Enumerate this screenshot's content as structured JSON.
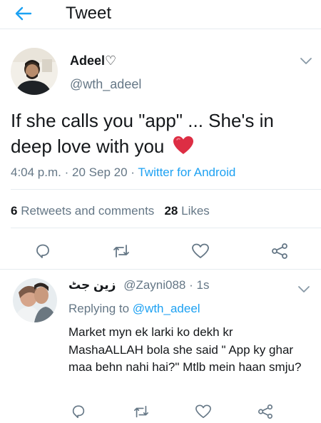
{
  "header": {
    "title": "Tweet",
    "back_icon": "arrow-left-icon"
  },
  "tweet": {
    "author_name": "Adeel♡",
    "author_handle": "@wth_adeel",
    "text": "If she calls you \"app\" ... She's in deep love with you",
    "emoji": "red-heart",
    "time": "4:04 p.m.",
    "date": "20 Sep 20",
    "separator": "·",
    "source": "Twitter for Android",
    "retweets_count": "6",
    "retweets_label": "Retweets and comments",
    "likes_count": "28",
    "likes_label": "Likes"
  },
  "actions": [
    "reply-icon",
    "retweet-icon",
    "like-icon",
    "share-icon"
  ],
  "reply": {
    "name": "زین جٹ",
    "handle": "@Zayni088",
    "separator": "·",
    "time": "1s",
    "replying_prefix": "Replying to",
    "replying_to": "@wth_adeel",
    "text": "Market myn ek larki ko dekh kr MashaALLAH bola she said \" App ky ghar maa behn nahi hai?\" Mtlb mein haan smju?"
  },
  "colors": {
    "accent": "#1da1f2",
    "secondary_text": "#657786",
    "primary_text": "#14171a",
    "divider": "#e6ecf0",
    "heart": "#e0245e"
  }
}
